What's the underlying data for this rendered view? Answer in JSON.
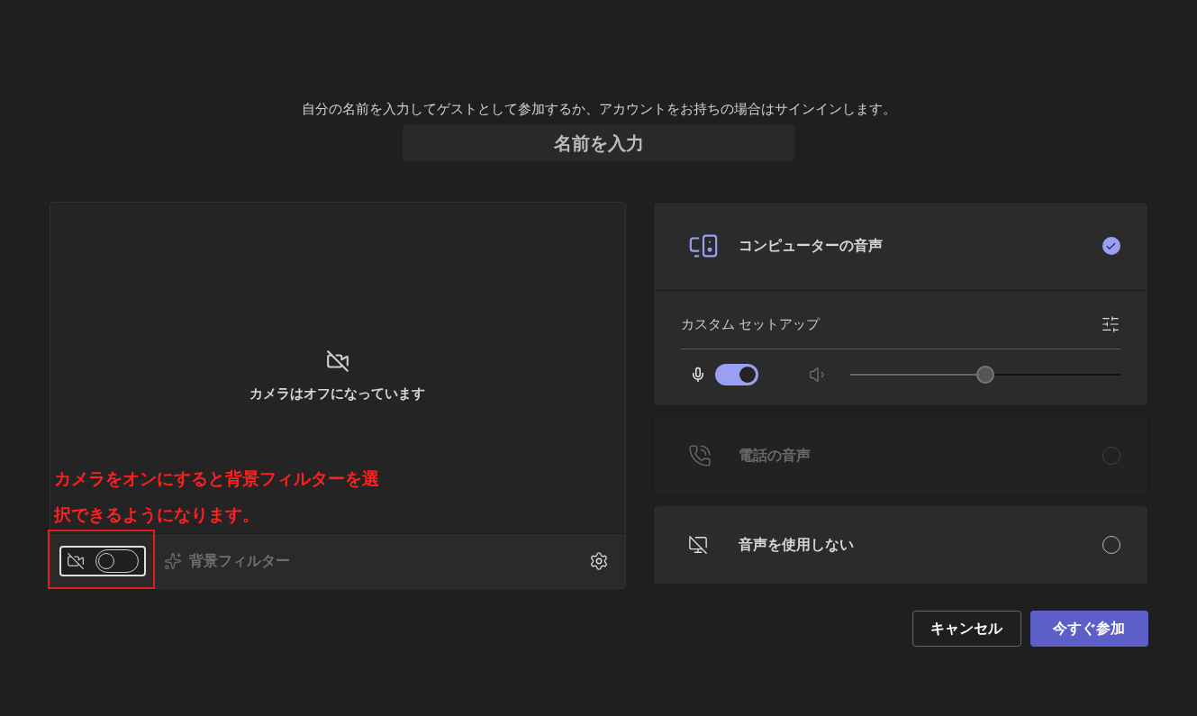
{
  "intro": "自分の名前を入力してゲストとして参加するか、アカウントをお持ちの場合はサインインします。",
  "name_field": {
    "placeholder": "名前を入力"
  },
  "video": {
    "camera_on": false,
    "status": "カメラはオフになっています",
    "annotation_lines": [
      "カメラをオンにすると背景フィルターを選",
      "択できるようになります。"
    ],
    "background_filter": {
      "label": "背景フィルター",
      "disabled": true
    }
  },
  "audio_options": [
    {
      "kind": "computer",
      "label": "コンピューターの音声",
      "selected": true,
      "disabled": false,
      "setup": {
        "label": "カスタム セットアップ",
        "mic_on": true,
        "level": 0.5
      }
    },
    {
      "kind": "phone",
      "label": "電話の音声",
      "selected": false,
      "disabled": true
    },
    {
      "kind": "none",
      "label": "音声を使用しない",
      "selected": false,
      "disabled": false
    }
  ],
  "buttons": [
    {
      "kind": "secondary",
      "label": "キャンセル"
    },
    {
      "kind": "primary",
      "label": "今すぐ参加"
    }
  ]
}
